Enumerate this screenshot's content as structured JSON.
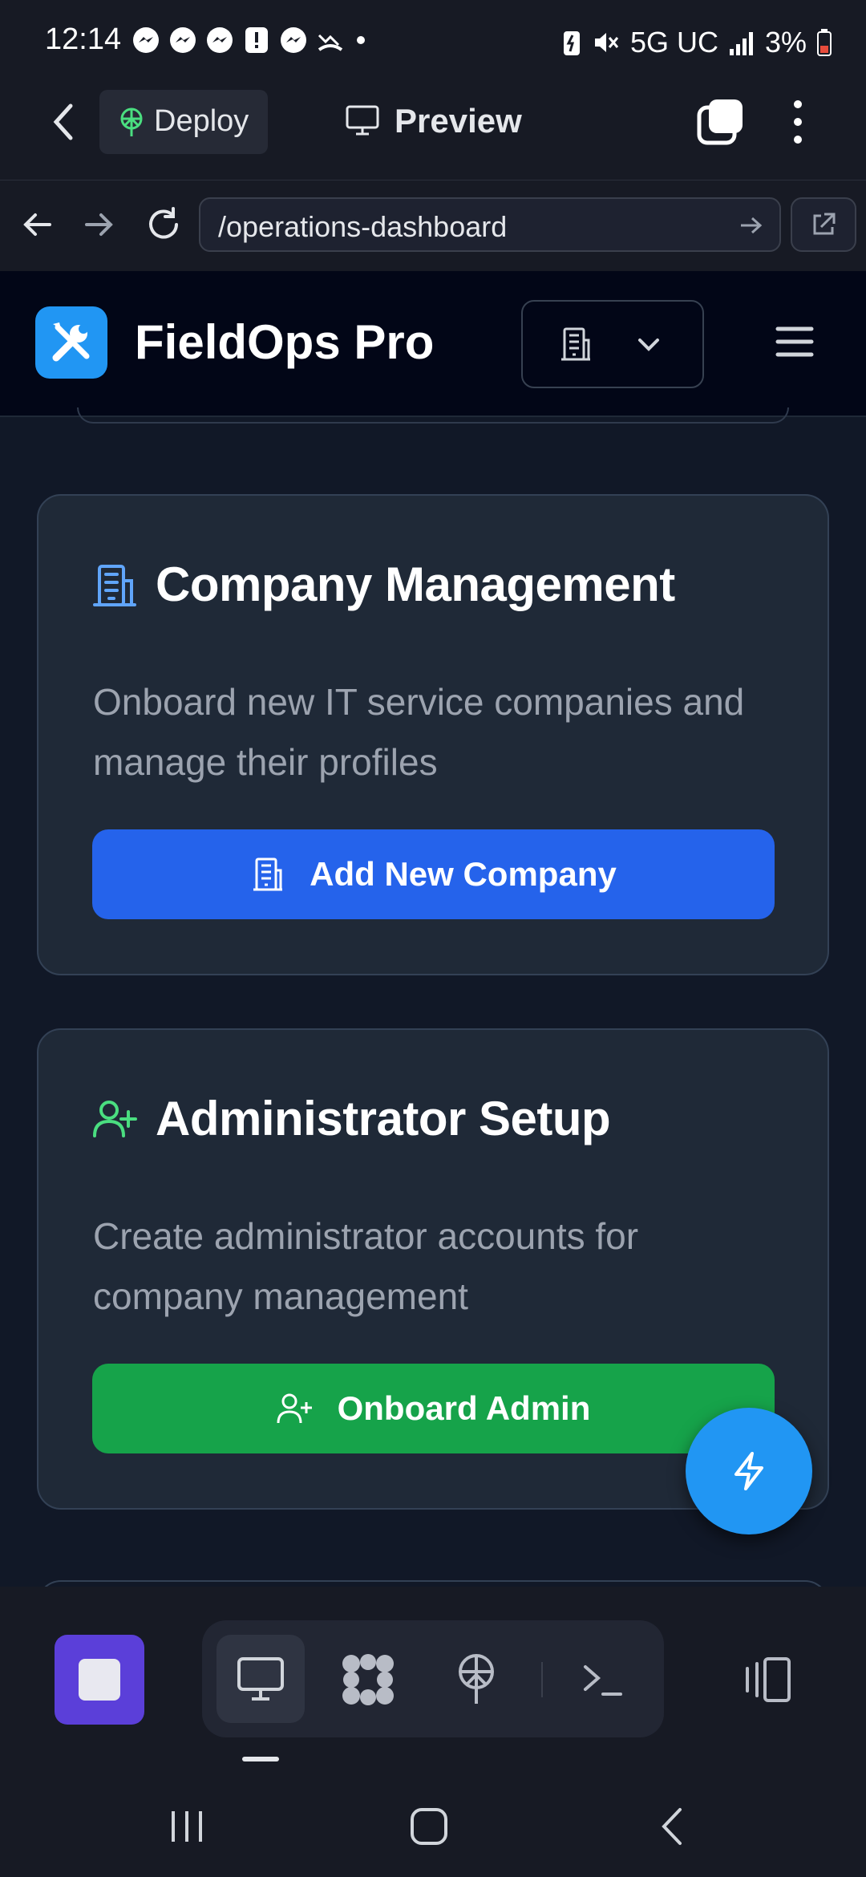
{
  "status_bar": {
    "time": "12:14",
    "network": "5G UC",
    "battery": "3%"
  },
  "replit_bar": {
    "deploy_label": "Deploy",
    "preview_label": "Preview"
  },
  "url_bar": {
    "url": "/operations-dashboard"
  },
  "site": {
    "title": "FieldOps Pro",
    "brand_color": "#2196f3"
  },
  "cards": {
    "company": {
      "title": "Company Management",
      "description": "Onboard new IT service companies and manage their profiles",
      "button_label": "Add New Company"
    },
    "admin": {
      "title": "Administrator Setup",
      "description": "Create administrator accounts for company management",
      "button_label": "Onboard Admin"
    }
  },
  "icons": {
    "logo": "wrench-screwdriver-icon",
    "company": "building-icon",
    "admin": "user-plus-icon",
    "fab": "lightning-icon"
  },
  "colors": {
    "primary_button": "#2563eb",
    "success_button": "#16a34a",
    "fab": "#2196f3",
    "stop_button": "#5b3fd9"
  }
}
